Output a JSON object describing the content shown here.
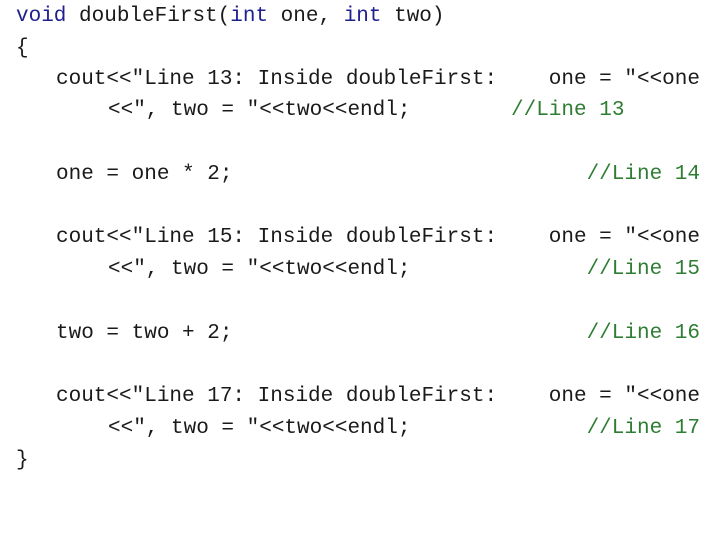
{
  "colors": {
    "keyword": "#1f1f8f",
    "comment": "#2e7d32",
    "text": "#1a1a1a",
    "background": "#ffffff"
  },
  "code": {
    "signature": {
      "kw_void": "void",
      "name": " doubleFirst(",
      "kw_int1": "int",
      "param1": " one, ",
      "kw_int2": "int",
      "param2": " two)"
    },
    "open_brace": "{",
    "close_brace": "}",
    "statements": [
      {
        "line1_left": "cout<<\"Line 13: Inside doubleFirst:",
        "line1_right": "one = \"<<one",
        "line2_left": "<<\", two = \"<<two<<endl;",
        "comment": "//Line 13"
      },
      {
        "text": "one = one * 2;",
        "comment": "//Line 14"
      },
      {
        "line1_left": "cout<<\"Line 15: Inside doubleFirst:",
        "line1_right": "one = \"<<one",
        "line2_left": "<<\", two = \"<<two<<endl;",
        "comment": "//Line 15"
      },
      {
        "text": "two = two + 2;",
        "comment": "//Line 16"
      },
      {
        "line1_left": "cout<<\"Line 17: Inside doubleFirst:",
        "line1_right": "one = \"<<one",
        "line2_left": "<<\", two = \"<<two<<endl;",
        "comment": "//Line 17"
      }
    ]
  }
}
